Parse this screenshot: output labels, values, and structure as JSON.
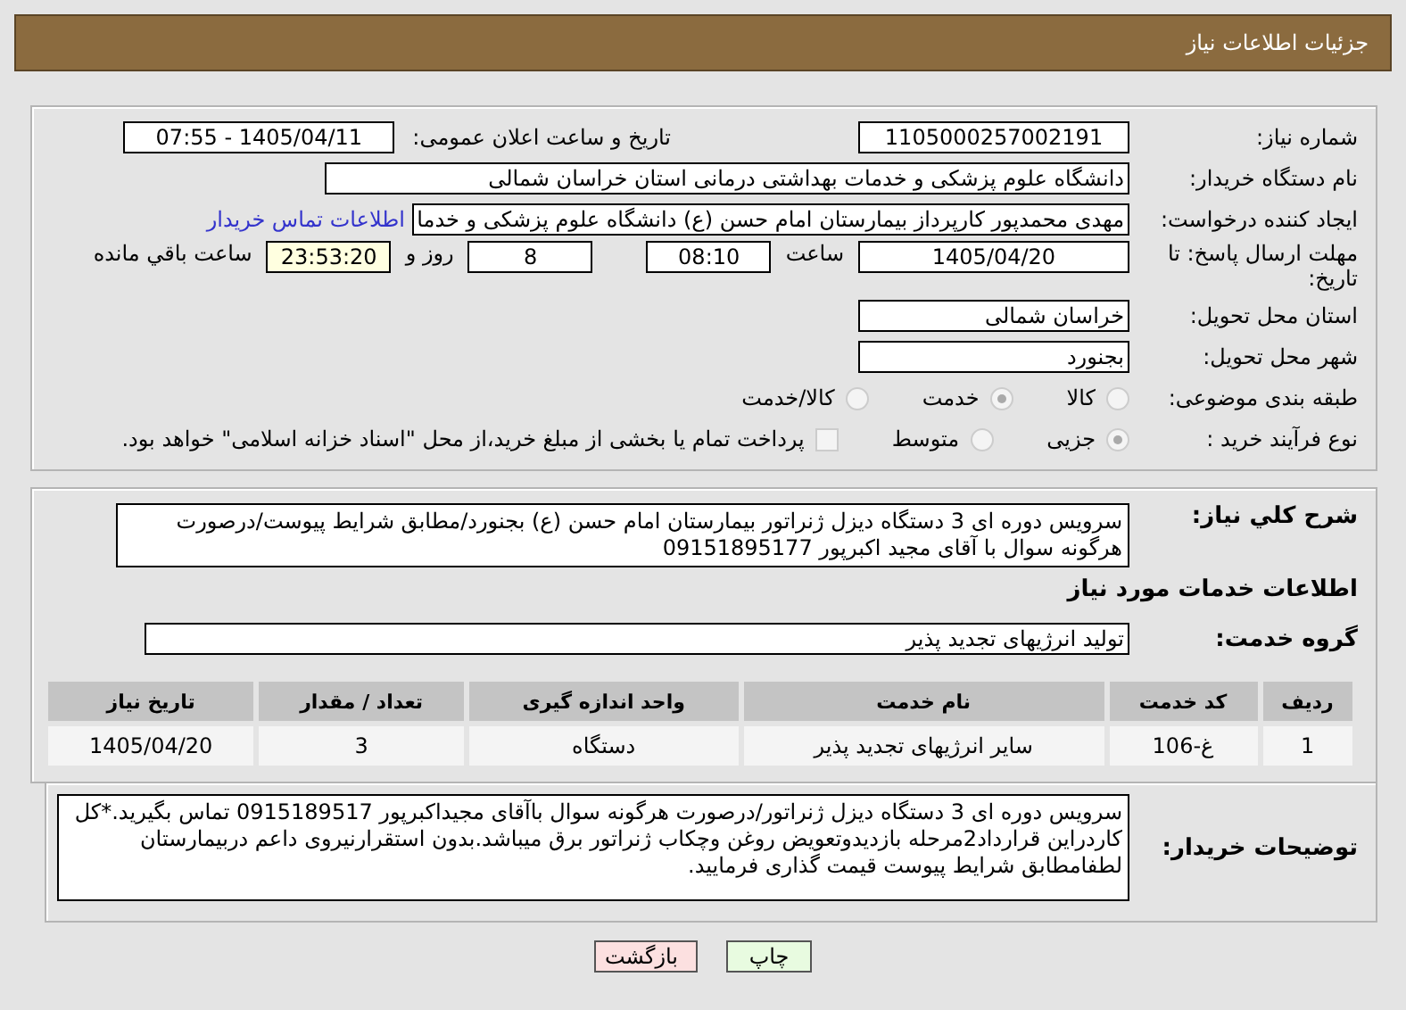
{
  "header": {
    "title": "جزئیات اطلاعات نیاز"
  },
  "need_number": {
    "label": "شماره نیاز:",
    "value": "1105000257002191"
  },
  "announce": {
    "label": "تاریخ و ساعت اعلان عمومی:",
    "value": "1405/04/11 - 07:55"
  },
  "buyer": {
    "label": "نام دستگاه خریدار:",
    "value": "دانشگاه علوم پزشکی و خدمات بهداشتی درمانی استان خراسان شمالی"
  },
  "creator": {
    "label": "ایجاد کننده درخواست:",
    "value": "مهدی محمدپور کارپرداز بیمارستان امام حسن (ع) دانشگاه علوم پزشکی و خدما",
    "link": "اطلاعات تماس خریدار"
  },
  "deadline": {
    "label": "مهلت ارسال پاسخ: تا تاریخ:",
    "date": "1405/04/20",
    "time_label": "ساعت",
    "time": "08:10",
    "days": "8",
    "days_label": "روز و",
    "remaining": "23:53:20",
    "remaining_label": "ساعت باقي مانده"
  },
  "province": {
    "label": "استان محل تحویل:",
    "value": "خراسان شمالی"
  },
  "city": {
    "label": "شهر محل تحویل:",
    "value": "بجنورد"
  },
  "category": {
    "label": "طبقه بندی موضوعی:",
    "options": [
      {
        "label": "کالا",
        "selected": false
      },
      {
        "label": "خدمت",
        "selected": true
      },
      {
        "label": "کالا/خدمت",
        "selected": false
      }
    ]
  },
  "process": {
    "label": "نوع فرآیند خرید :",
    "options": [
      {
        "label": "جزیی",
        "selected": true
      },
      {
        "label": "متوسط",
        "selected": false
      }
    ],
    "treasury": {
      "label": "پرداخت تمام یا بخشی از مبلغ خرید،از محل \"اسناد خزانه اسلامی\" خواهد بود.",
      "checked": false
    }
  },
  "summary": {
    "label": "شرح کلي نیاز:",
    "value": "سرویس دوره ای  3 دستگاه دیزل ژنراتور بیمارستان امام حسن (ع) بجنورد/مطابق شرایط پیوست/درصورت هرگونه سوال با آقای مجید اکبرپور 09151895177"
  },
  "services_title": "اطلاعات خدمات مورد نیاز",
  "service_group": {
    "label": "گروه خدمت:",
    "value": "تولید انرژیهای تجدید پذیر"
  },
  "table": {
    "columns": [
      "ردیف",
      "کد خدمت",
      "نام خدمت",
      "واحد اندازه گیری",
      "تعداد / مقدار",
      "تاریخ نیاز"
    ],
    "rows": [
      [
        "1",
        "غ-106",
        "سایر انرژیهای تجدید پذیر",
        "دستگاه",
        "3",
        "1405/04/20"
      ]
    ]
  },
  "notes": {
    "label": "توضیحات خریدار:",
    "value": "سرویس دوره ای  3 دستگاه دیزل ژنراتور/درصورت هرگونه سوال باآقای مجیداکبرپور 0915189517 تماس بگیرید.*کل کاردراین قرارداد2مرحله بازدیدوتعویض روغن وچکاب ژنراتور برق میباشد.بدون استقرارنیروی داعم دربیمارستان لطفامطابق شرایط پیوست قیمت گذاری فرمایید."
  },
  "buttons": [
    {
      "label": "چاپ",
      "kind": "print"
    },
    {
      "label": "بازگشت",
      "kind": "back"
    }
  ]
}
